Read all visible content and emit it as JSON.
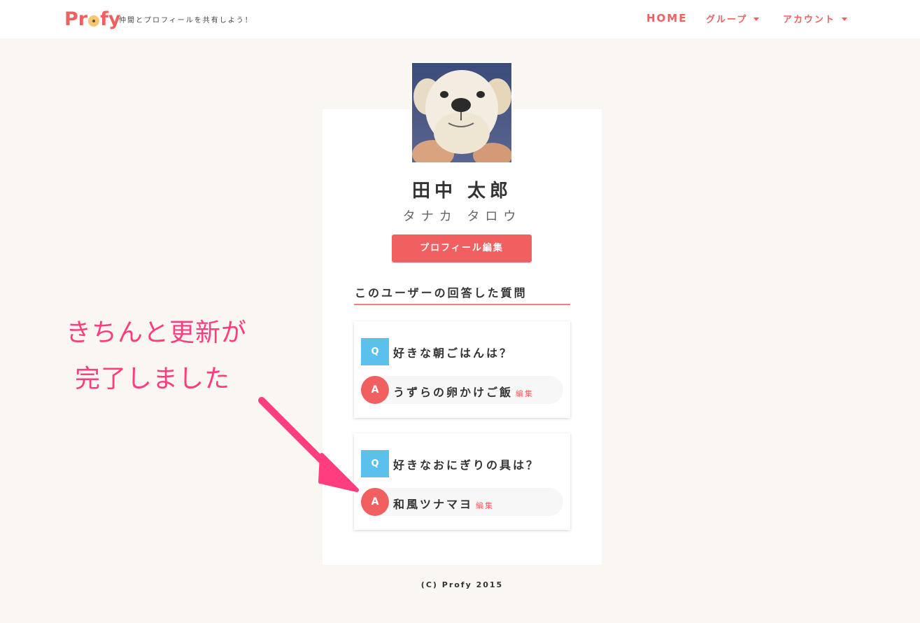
{
  "header": {
    "logo": "Profy",
    "tagline": "仲間とプロフィールを共有しよう！",
    "nav": {
      "home": "HOME",
      "group": "グループ",
      "account": "アカウント"
    }
  },
  "profile": {
    "name": "田中 太郎",
    "kana": "タナカ タロウ",
    "edit_button": "プロフィール編集"
  },
  "answers_section": {
    "title": "このユーザーの回答した質問",
    "q_badge": "Q",
    "a_badge": "A",
    "edit_label": "編集",
    "items": [
      {
        "question": "好きな朝ごはんは？",
        "answer": "うずらの卵かけご飯"
      },
      {
        "question": "好きなおにぎりの具は？",
        "answer": "和風ツナマヨ"
      }
    ]
  },
  "footer": {
    "copyright": "(C) Profy 2015"
  },
  "annotation": {
    "line1": "きちんと更新が",
    "line2": "完了しました"
  },
  "colors": {
    "accent": "#f06060",
    "q_badge": "#5bc0eb",
    "annotation": "#ff3d7f",
    "background": "#faf7f2"
  }
}
